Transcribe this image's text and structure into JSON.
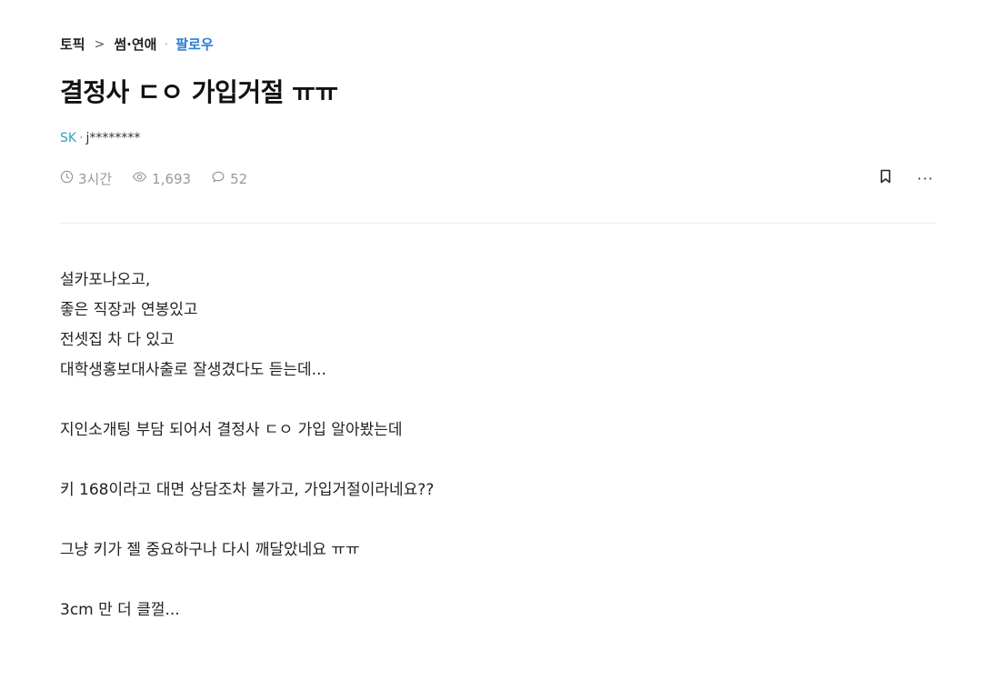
{
  "breadcrumb": {
    "topic": "토픽",
    "separator": ">",
    "category": "썸·연애",
    "dot": "·",
    "follow": "팔로우"
  },
  "post": {
    "title": "결정사 ㄷㅇ 가입거절 ㅠㅠ",
    "author_company": "SK",
    "author_separator": "·",
    "author_nick": "j********",
    "time": "3시간",
    "views": "1,693",
    "comments": "52",
    "more_label": "···",
    "body": [
      "설카포나오고,",
      "좋은 직장과 연봉있고",
      "전셋집 차 다 있고",
      "대학생홍보대사출로 잘생겼다도 듣는데...",
      "",
      "지인소개팅 부담 되어서 결정사 ㄷㅇ 가입 알아봤는데",
      "",
      "키 168이라고 대면 상담조차 불가고, 가입거절이라네요??",
      "",
      "그냥 키가 젤 중요하구나 다시 깨달았네요 ㅠㅠ",
      "",
      "3cm 만 더 클껄..."
    ]
  },
  "colors": {
    "follow": "#2a7fd4",
    "company": "#2aa3c9",
    "meta": "#999999"
  },
  "icons": {
    "time": "clock-icon",
    "views": "eye-icon",
    "comments": "comment-icon",
    "bookmark": "bookmark-icon",
    "more": "more-icon"
  }
}
